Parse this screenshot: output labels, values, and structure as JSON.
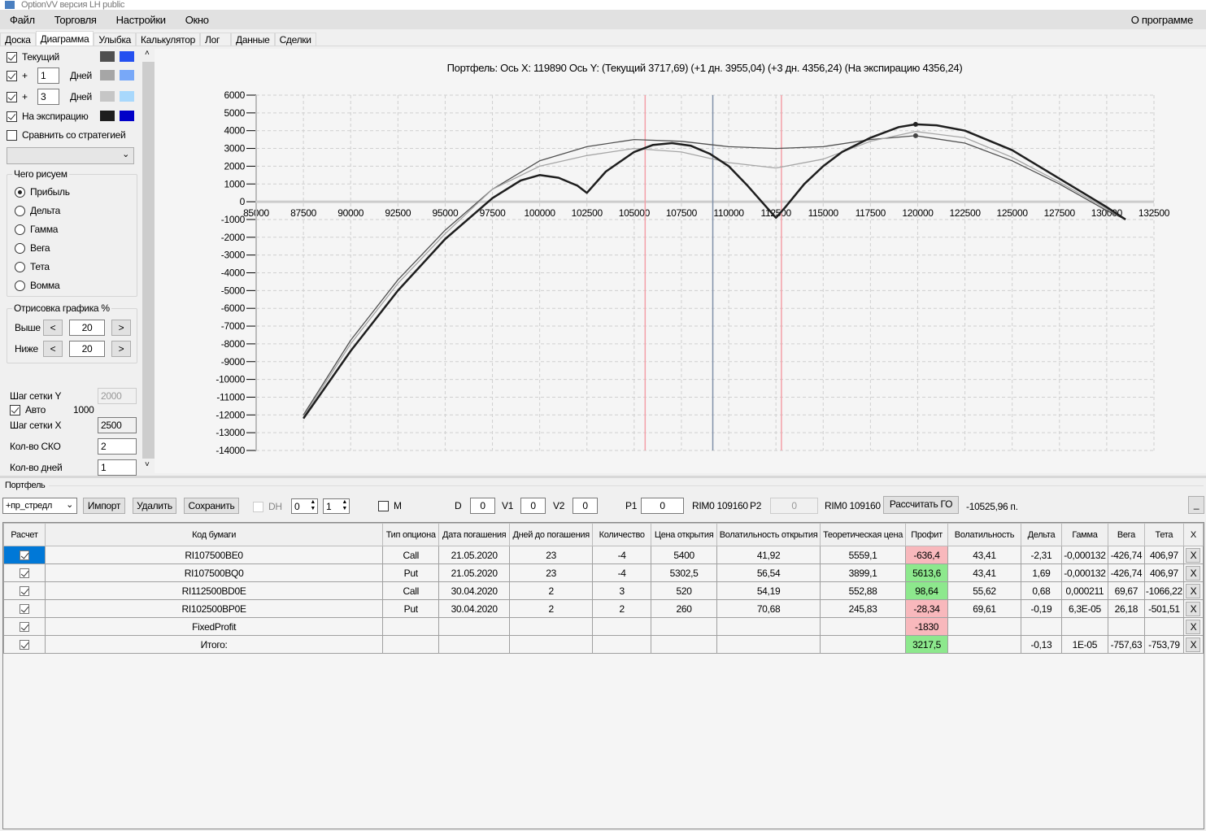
{
  "window": {
    "title": "OptionVV версия LH public"
  },
  "menu": {
    "items": [
      "Файл",
      "Торговля",
      "Настройки",
      "Окно"
    ],
    "about": "О программе"
  },
  "tabs": [
    "Доска",
    "Диаграмма",
    "Улыбка",
    "Калькулятор",
    "Лог",
    "Данные",
    "Сделки"
  ],
  "active_tab": "Диаграмма",
  "left": {
    "current": {
      "label": "Текущий",
      "checked": true,
      "colors": [
        "#505050",
        "#2450f0"
      ]
    },
    "plus1": {
      "plus": "+",
      "value": "1",
      "unit": "Дней",
      "checked": true,
      "colors": [
        "#a6a6a6",
        "#78a8f8"
      ]
    },
    "plus3": {
      "plus": "+",
      "value": "3",
      "unit": "Дней",
      "checked": true,
      "colors": [
        "#c6c6c6",
        "#a8d8fc"
      ]
    },
    "expiry": {
      "label": "На экспирацию",
      "checked": true,
      "colors": [
        "#1e1e1e",
        "#0000c8"
      ]
    },
    "compare": {
      "label": "Сравнить со стратегией",
      "checked": false
    },
    "draw_group": "Чего рисуем",
    "radios": [
      "Прибыль",
      "Дельта",
      "Гамма",
      "Вега",
      "Тета",
      "Вомма"
    ],
    "selected_radio": "Прибыль",
    "range_group": "Отрисовка графика %",
    "above": {
      "label": "Выше",
      "dec": "<",
      "value": "20",
      "inc": ">"
    },
    "below": {
      "label": "Ниже",
      "dec": "<",
      "value": "20",
      "inc": ">"
    },
    "grid_y": {
      "label": "Шаг сетки Y",
      "value": "2000"
    },
    "auto": {
      "label": "Авто",
      "checked": true,
      "value": "1000"
    },
    "grid_x": {
      "label": "Шаг сетки X",
      "value": "2500"
    },
    "sko": {
      "label": "Кол-во СКО",
      "value": "2"
    },
    "days": {
      "label": "Кол-во дней",
      "value": "1"
    }
  },
  "chart_data": {
    "type": "line",
    "title": "Портфель: Ось X: 119890 Ось Y:  (Текущий 3717,69)  (+1 дн. 3955,04)  (+3 дн. 4356,24)  (На экспирацию 4356,24)",
    "xlim": [
      85000,
      132500
    ],
    "ylim": [
      -14000,
      6000
    ],
    "xticks": [
      "85000",
      "87500",
      "90000",
      "92500",
      "95000",
      "97500",
      "100000",
      "102500",
      "105000",
      "107500",
      "110000",
      "112500",
      "115000",
      "117500",
      "120000",
      "122500",
      "125000",
      "127500",
      "130000",
      "132500"
    ],
    "yticks": [
      "6000",
      "5000",
      "4000",
      "3000",
      "2000",
      "1000",
      "0",
      "-1000",
      "-2000",
      "-3000",
      "-4000",
      "-5000",
      "-6000",
      "-7000",
      "-8000",
      "-9000",
      "-10000",
      "-11000",
      "-12000",
      "-13000",
      "-14000"
    ],
    "grid": true,
    "vlines": [
      {
        "x": 105580,
        "color": "#f4a0a8"
      },
      {
        "x": 109160,
        "color": "#8090a8"
      },
      {
        "x": 112790,
        "color": "#f4a0a8"
      }
    ],
    "series": [
      {
        "name": "Текущий",
        "color": "#505050",
        "points": [
          [
            87500,
            -12000
          ],
          [
            90000,
            -7800
          ],
          [
            92500,
            -4400
          ],
          [
            95000,
            -1600
          ],
          [
            97500,
            700
          ],
          [
            100000,
            2300
          ],
          [
            102500,
            3100
          ],
          [
            105000,
            3500
          ],
          [
            107500,
            3400
          ],
          [
            110000,
            3100
          ],
          [
            112500,
            3000
          ],
          [
            115000,
            3100
          ],
          [
            117500,
            3500
          ],
          [
            119890,
            3717
          ],
          [
            122500,
            3300
          ],
          [
            125000,
            2300
          ],
          [
            127500,
            1000
          ],
          [
            130000,
            -500
          ],
          [
            131000,
            -1000
          ]
        ]
      },
      {
        "name": "+1 дн.",
        "color": "#a6a6a6",
        "points": [
          [
            87500,
            -12100
          ],
          [
            90000,
            -8000
          ],
          [
            92500,
            -4600
          ],
          [
            95000,
            -1800
          ],
          [
            97500,
            700
          ],
          [
            100000,
            2000
          ],
          [
            102500,
            2600
          ],
          [
            105000,
            3000
          ],
          [
            107500,
            2800
          ],
          [
            110000,
            2200
          ],
          [
            112500,
            1900
          ],
          [
            115000,
            2400
          ],
          [
            117500,
            3400
          ],
          [
            119890,
            3955
          ],
          [
            122500,
            3600
          ],
          [
            125000,
            2500
          ],
          [
            127500,
            1100
          ],
          [
            130000,
            -400
          ],
          [
            131000,
            -1000
          ]
        ]
      },
      {
        "name": "На экспирацию",
        "color": "#1e1e1e",
        "points": [
          [
            87500,
            -12200
          ],
          [
            90000,
            -8400
          ],
          [
            92500,
            -5000
          ],
          [
            95000,
            -2100
          ],
          [
            97500,
            200
          ],
          [
            99000,
            1200
          ],
          [
            100000,
            1500
          ],
          [
            101000,
            1350
          ],
          [
            102000,
            900
          ],
          [
            102500,
            500
          ],
          [
            103500,
            1700
          ],
          [
            105000,
            2800
          ],
          [
            106000,
            3200
          ],
          [
            107000,
            3300
          ],
          [
            108000,
            3150
          ],
          [
            109000,
            2700
          ],
          [
            110000,
            2000
          ],
          [
            111000,
            900
          ],
          [
            112000,
            -300
          ],
          [
            112500,
            -900
          ],
          [
            113000,
            -300
          ],
          [
            114000,
            1000
          ],
          [
            115000,
            2000
          ],
          [
            116000,
            2800
          ],
          [
            117500,
            3600
          ],
          [
            119000,
            4200
          ],
          [
            119890,
            4356
          ],
          [
            121000,
            4300
          ],
          [
            122500,
            4000
          ],
          [
            125000,
            2900
          ],
          [
            127500,
            1300
          ],
          [
            130000,
            -300
          ],
          [
            131000,
            -1000
          ]
        ]
      }
    ]
  },
  "portfolio": {
    "label": "Портфель",
    "selected": "+пр_стредл",
    "import": "Импорт",
    "delete": "Удалить",
    "save": "Сохранить",
    "dh": {
      "label": "DH",
      "checked": false,
      "v1": "0",
      "v2": "1"
    },
    "m": {
      "label": "M",
      "checked": false
    },
    "d": {
      "label": "D",
      "value": "0"
    },
    "v1": {
      "label": "V1",
      "value": "0"
    },
    "v2": {
      "label": "V2",
      "value": "0"
    },
    "p1": {
      "label": "P1",
      "value": "0"
    },
    "rim1": "RIM0 109160",
    "p2": {
      "label": "P2",
      "value": "0"
    },
    "rim2": "RIM0 109160",
    "calc": "Рассчитать ГО",
    "go_value": "-10525,96 п.",
    "minimize": "_"
  },
  "table": {
    "headers": [
      "Расчет",
      "Код бумаги",
      "Тип опциона",
      "Дата погашения",
      "Дней до погашения",
      "Количество",
      "Цена открытия",
      "Волатильность открытия",
      "Теоретическая цена",
      "Профит",
      "Волатильность",
      "Дельта",
      "Гамма",
      "Вега",
      "Тета",
      "X"
    ],
    "rows": [
      [
        "RI107500BE0",
        "Call",
        "21.05.2020",
        "23",
        "-4",
        "5400",
        "41,92",
        "5559,1",
        "-636,4",
        "43,41",
        "-2,31",
        "-0,000132",
        "-426,74",
        "406,97",
        "X"
      ],
      [
        "RI107500BQ0",
        "Put",
        "21.05.2020",
        "23",
        "-4",
        "5302,5",
        "56,54",
        "3899,1",
        "5613,6",
        "43,41",
        "1,69",
        "-0,000132",
        "-426,74",
        "406,97",
        "X"
      ],
      [
        "RI112500BD0E",
        "Call",
        "30.04.2020",
        "2",
        "3",
        "520",
        "54,19",
        "552,88",
        "98,64",
        "55,62",
        "0,68",
        "0,000211",
        "69,67",
        "-1066,22",
        "X"
      ],
      [
        "RI102500BP0E",
        "Put",
        "30.04.2020",
        "2",
        "2",
        "260",
        "70,68",
        "245,83",
        "-28,34",
        "69,61",
        "-0,19",
        "6,3E-05",
        "26,18",
        "-501,51",
        "X"
      ],
      [
        "FixedProfit",
        "",
        "",
        "",
        "",
        "",
        "",
        "",
        "-1830",
        "",
        "",
        "",
        "",
        "",
        "X"
      ],
      [
        "Итого:",
        "",
        "",
        "",
        "",
        "",
        "",
        "",
        "3217,5",
        "",
        "-0,13",
        "1E-05",
        "-757,63",
        "-753,79",
        "X"
      ]
    ],
    "profit_colors": {
      "negative": "#f8b8bc",
      "positive": "#8de88d"
    }
  }
}
